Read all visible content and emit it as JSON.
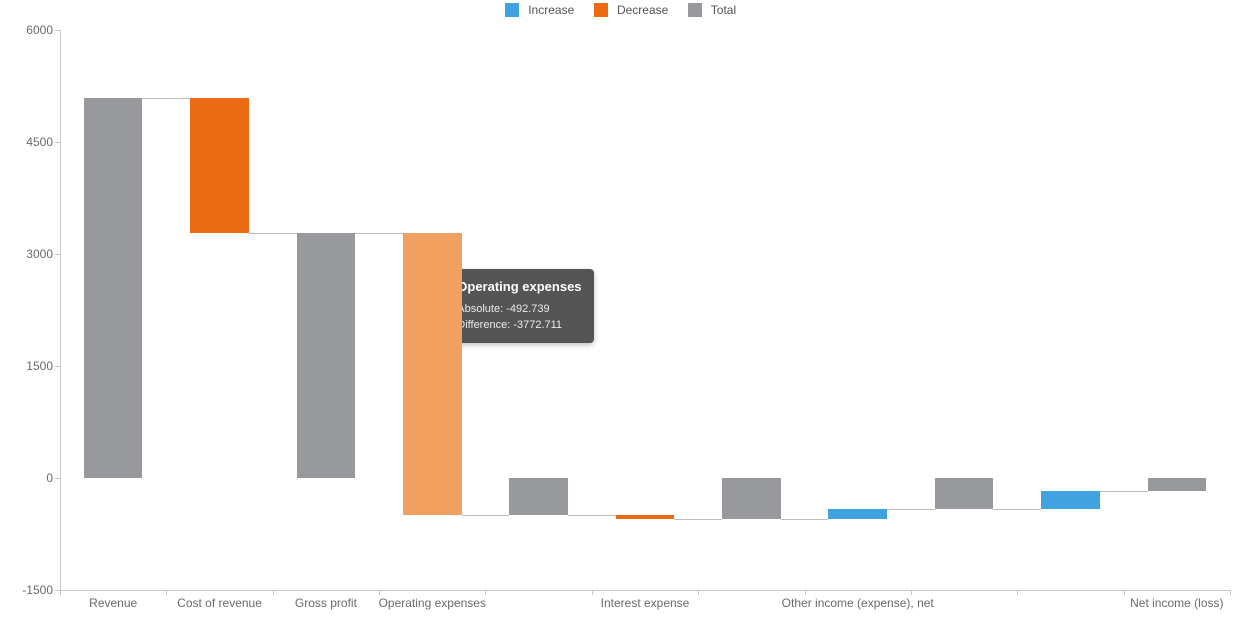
{
  "legend": {
    "increase": {
      "label": "Increase",
      "color": "#40a3e0"
    },
    "decrease": {
      "label": "Decrease",
      "color": "#ec6b12"
    },
    "total": {
      "label": "Total",
      "color": "#97999c"
    }
  },
  "chart_data": {
    "type": "bar",
    "subtype": "waterfall",
    "ylim": [
      -1500,
      6000
    ],
    "yticks": [
      -1500,
      0,
      1500,
      3000,
      4500,
      6000
    ],
    "categories": [
      "Revenue",
      "Cost of revenue",
      "Gross profit",
      "Operating expenses",
      "",
      "Interest expense",
      "",
      "Other income (expense), net",
      "",
      "",
      "Net income (loss)"
    ],
    "series": [
      {
        "name": "waterfall",
        "points": [
          {
            "label": "Revenue",
            "kind": "total",
            "start": 0,
            "end": 5087.49,
            "absolute": 5087.49
          },
          {
            "label": "Cost of revenue",
            "kind": "decrease",
            "start": 5087.49,
            "end": 3279.97,
            "absolute": 3279.97,
            "difference": -1807.52
          },
          {
            "label": "Gross profit",
            "kind": "total",
            "start": 0,
            "end": 3279.97,
            "absolute": 3279.97
          },
          {
            "label": "Operating expenses",
            "kind": "decrease",
            "start": 3279.97,
            "end": -492.739,
            "absolute": -492.739,
            "difference": -3772.711
          },
          {
            "label": "",
            "kind": "total",
            "start": 0,
            "end": -492.74,
            "absolute": -492.74
          },
          {
            "label": "Interest expense",
            "kind": "decrease",
            "start": -492.74,
            "end": -550,
            "absolute": -550,
            "difference": -57.26
          },
          {
            "label": "",
            "kind": "total",
            "start": 0,
            "end": -550,
            "absolute": -550
          },
          {
            "label": "Other income (expense), net",
            "kind": "increase",
            "start": -550,
            "end": -420,
            "absolute": -420,
            "difference": 130
          },
          {
            "label": "",
            "kind": "total",
            "start": 0,
            "end": -420,
            "absolute": -420
          },
          {
            "label": "",
            "kind": "increase",
            "start": -420,
            "end": -180,
            "absolute": -180,
            "difference": 240
          },
          {
            "label": "Net income (loss)",
            "kind": "total",
            "start": 0,
            "end": -180,
            "absolute": -180
          }
        ]
      }
    ]
  },
  "tooltip": {
    "title": "Operating expenses",
    "absolute_label": "Absolute:",
    "absolute_value": "-492.739",
    "difference_label": "Difference:",
    "difference_value": "-3772.711",
    "target_index": 3
  },
  "colors": {
    "increase": "#40a3e0",
    "decrease": "#ec6b12",
    "decrease_hover": "#f2a05f",
    "total": "#97999c"
  }
}
